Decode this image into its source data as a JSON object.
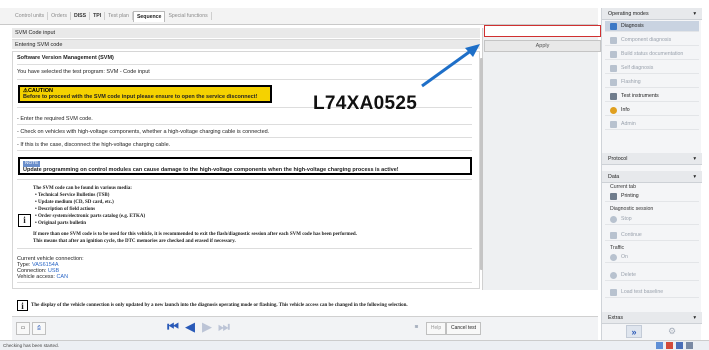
{
  "tabs": [
    "Control units",
    "Orders",
    "DISS",
    "TPI",
    "Test plan",
    "Sequence",
    "Special functions"
  ],
  "header": {
    "line1": "SVM Code input",
    "line2": "Entering SVM code"
  },
  "input": {
    "value": "",
    "placeholder": ""
  },
  "apply_label": "Apply",
  "content": {
    "title": "Software Version Management (SVM)",
    "intro": "You have selected the test program: SVM - Code input",
    "caution_tag": "CAUTION",
    "caution_text": "Before to proceed with the SVM code input please ensure to open the service disconnect!",
    "step1": "- Enter the required SVM code.",
    "step2": "- Check on vehicles with high-voltage components, whether a high-voltage charging cable is connected.",
    "step3": "- If this is the case, disconnect the high-voltage charging cable.",
    "note_tag": "NOTE",
    "note_text": "Update programming on control modules can cause damage to the high-voltage components when the high-voltage charging process is active!",
    "sources_title": "The SVM code can be found in various media:",
    "sources": [
      "Technical Service Bulletins (TSB)",
      "Update medium (CD, SD card, etc.)",
      "Description of field actions",
      "Order system/electronic parts catalog (e.g. ETKA)",
      "Original parts bulletin"
    ],
    "info_p1": "If more than one SVM code is to be used for this vehicle, it is recommended to exit the flash/diagnostic session after each SVM code has been performed.",
    "info_p2": "This means that after an ignition cycle, the DTC memories are checked and erased if necessary.",
    "connection_title": "Current vehicle connection:",
    "type_label": "Type:",
    "type_value": "VAS6154A",
    "connection_label": "Connection:",
    "connection_value": "USB",
    "access_label": "Vehicle access:",
    "access_value": "CAN",
    "footer_info": "The display of the vehicle connection is only updated by a new launch into the diagnosis operating mode or flashing. This vehicle access can be changed in the following selection."
  },
  "annotation": {
    "text": "L74XA0525",
    "arrow_color": "#1e6fc8"
  },
  "bottom": {
    "help_label": "Help",
    "cancel_label": "Cancel test"
  },
  "status": {
    "text": "Checking has been started."
  },
  "sidebar": {
    "operating_modes": "Operating modes",
    "modes": [
      {
        "label": "Diagnosis",
        "state": "active",
        "color": "#3b78c6"
      },
      {
        "label": "Component diagnosis",
        "state": "disabled",
        "color": "#b8c2cf"
      },
      {
        "label": "Build status documentation",
        "state": "disabled",
        "color": "#b8c2cf"
      },
      {
        "label": "Self diagnosis",
        "state": "disabled",
        "color": "#b8c2cf"
      },
      {
        "label": "Flashing",
        "state": "disabled",
        "color": "#b8c2cf"
      },
      {
        "label": "Test instruments",
        "state": "enabled",
        "color": "#6f7c8c"
      },
      {
        "label": "Info",
        "state": "enabled",
        "color": "#e0a020"
      },
      {
        "label": "Admin",
        "state": "disabled",
        "color": "#b8c2cf"
      }
    ],
    "protocol": "Protocol",
    "data": "Data",
    "current_tab": "Current tab",
    "printing": "Printing",
    "diagnostic_session": "Diagnostic session",
    "stop": "Stop",
    "continue": "Continue",
    "traffic": "Traffic",
    "on": "On",
    "delete": "Delete",
    "load_test_baseline": "Load test baseline",
    "extras": "Extras"
  }
}
